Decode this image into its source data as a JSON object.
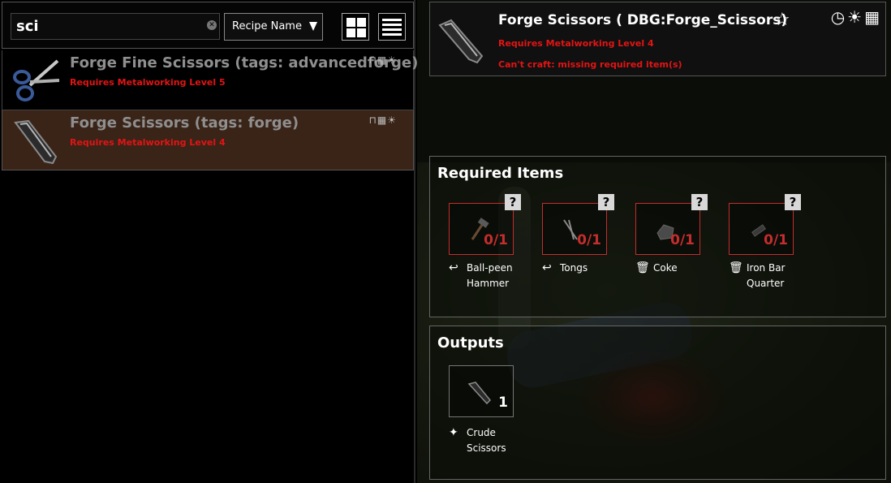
{
  "search": {
    "value": "sci"
  },
  "sort": {
    "selected": "Recipe Name"
  },
  "recipes": [
    {
      "name": "Forge Fine Scissors (tags: advancedforge)",
      "requirement": "Requires Metalworking Level 5",
      "icons": "⊓▦☀"
    },
    {
      "name": "Forge Scissors (tags: forge)",
      "requirement": "Requires Metalworking Level 4",
      "icons": "⊓▦☀"
    }
  ],
  "detail": {
    "title": "Forge Scissors ( DBG:Forge_Scissors)",
    "requirement": "Requires Metalworking Level 4",
    "error": "Can't craft: missing required item(s)",
    "icons": "◷☀▦"
  },
  "required": {
    "title": "Required Items",
    "items": [
      {
        "count": "0/1",
        "line1": "Ball-peen",
        "line2": "Hammer",
        "mark": "?",
        "icon": "return-icon",
        "glyph": "↩"
      },
      {
        "count": "0/1",
        "line1": "Tongs",
        "line2": "",
        "mark": "?",
        "icon": "return-icon",
        "glyph": "↩"
      },
      {
        "count": "0/1",
        "line1": "Coke",
        "line2": "",
        "mark": "?",
        "icon": "trash-icon",
        "glyph": "🗑"
      },
      {
        "count": "0/1",
        "line1": "Iron Bar",
        "line2": "Quarter",
        "mark": "?",
        "icon": "trash-icon",
        "glyph": "🗑"
      }
    ]
  },
  "outputs": {
    "title": "Outputs",
    "item": {
      "count": "1",
      "line1": "Crude",
      "line2": "Scissors",
      "icon": "sparkle-icon",
      "glyph": "✦"
    }
  },
  "colors": {
    "error": "#e21414",
    "selected_row": "#3a2418",
    "slot_border": "#c42d2d"
  }
}
